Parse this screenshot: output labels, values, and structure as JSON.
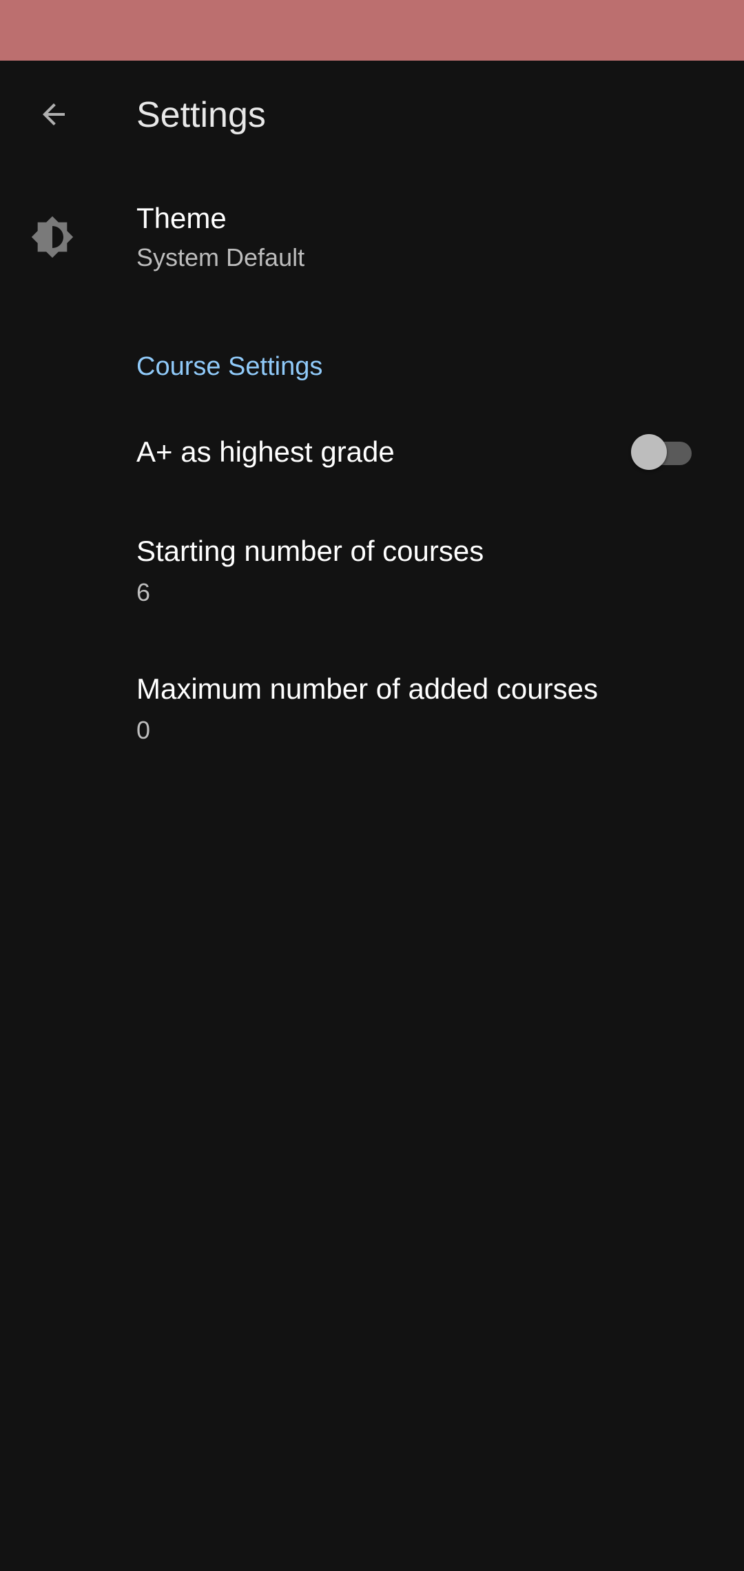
{
  "colors": {
    "status_bar": "#bc6f6f",
    "background": "#121212",
    "accent": "#90caf9"
  },
  "app_bar": {
    "title": "Settings",
    "back_icon": "arrow-back-icon"
  },
  "theme": {
    "icon": "brightness-icon",
    "title": "Theme",
    "summary": "System Default"
  },
  "course_settings": {
    "category_title": "Course Settings",
    "a_plus": {
      "title": "A+ as highest grade",
      "switch_on": false
    },
    "starting_courses": {
      "title": "Starting number of courses",
      "summary": "6"
    },
    "max_added_courses": {
      "title": "Maximum number of added courses",
      "summary": "0"
    }
  }
}
